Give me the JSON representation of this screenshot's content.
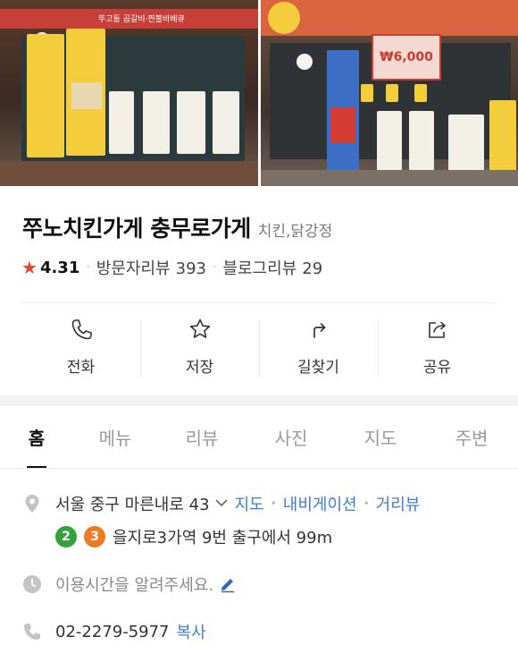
{
  "photos": {
    "left": {
      "awning_text": "뚜고동 곱갈비·찐불바베큐"
    },
    "right": {
      "price_sign": "₩6,000"
    }
  },
  "place": {
    "name": "쭈노치킨가게 충무로가게",
    "category": "치킨,닭강정",
    "rating": "4.31",
    "visitor_review_label": "방문자리뷰",
    "visitor_review_count": "393",
    "blog_review_label": "블로그리뷰",
    "blog_review_count": "29"
  },
  "actions": [
    {
      "label": "전화",
      "icon": "phone-icon"
    },
    {
      "label": "저장",
      "icon": "star-outline-icon"
    },
    {
      "label": "길찾기",
      "icon": "directions-icon"
    },
    {
      "label": "공유",
      "icon": "share-icon"
    }
  ],
  "tabs": [
    "홈",
    "메뉴",
    "리뷰",
    "사진",
    "지도",
    "주변"
  ],
  "active_tab": "홈",
  "info": {
    "address": "서울 중구 마른내로 43",
    "map_link": "지도",
    "navigation_link": "내비게이션",
    "distance_view_link": "거리뷰",
    "subway_lines": [
      {
        "number": "2",
        "color": "#33a23d"
      },
      {
        "number": "3",
        "color": "#ee7b23"
      }
    ],
    "subway_directions": "을지로3가역 9번 출구에서 99m",
    "hours_prompt": "이용시간을 알려주세요.",
    "phone": "02-2279-5977",
    "copy_label": "복사"
  },
  "colors": {
    "accent_blue": "#3e7fd6",
    "star_red": "#e8432b"
  }
}
